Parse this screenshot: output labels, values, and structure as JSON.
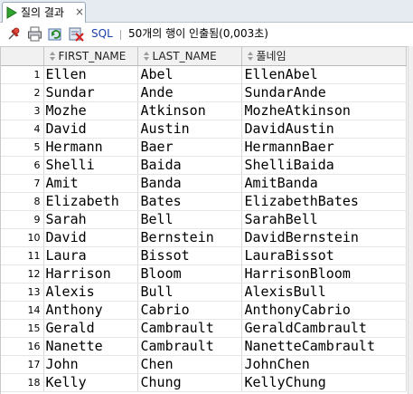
{
  "tab": {
    "label": "질의 결과",
    "close": "×"
  },
  "toolbar": {
    "sql_label": "SQL",
    "status": "50개의 행이 인출됨(0,003초)"
  },
  "columns": [
    "FIRST_NAME",
    "LAST_NAME",
    "풀네임"
  ],
  "rows": [
    [
      "1",
      "Ellen",
      "Abel",
      "EllenAbel"
    ],
    [
      "2",
      "Sundar",
      "Ande",
      "SundarAnde"
    ],
    [
      "3",
      "Mozhe",
      "Atkinson",
      "MozheAtkinson"
    ],
    [
      "4",
      "David",
      "Austin",
      "DavidAustin"
    ],
    [
      "5",
      "Hermann",
      "Baer",
      "HermannBaer"
    ],
    [
      "6",
      "Shelli",
      "Baida",
      "ShelliBaida"
    ],
    [
      "7",
      "Amit",
      "Banda",
      "AmitBanda"
    ],
    [
      "8",
      "Elizabeth",
      "Bates",
      "ElizabethBates"
    ],
    [
      "9",
      "Sarah",
      "Bell",
      "SarahBell"
    ],
    [
      "10",
      "David",
      "Bernstein",
      "DavidBernstein"
    ],
    [
      "11",
      "Laura",
      "Bissot",
      "LauraBissot"
    ],
    [
      "12",
      "Harrison",
      "Bloom",
      "HarrisonBloom"
    ],
    [
      "13",
      "Alexis",
      "Bull",
      "AlexisBull"
    ],
    [
      "14",
      "Anthony",
      "Cabrio",
      "AnthonyCabrio"
    ],
    [
      "15",
      "Gerald",
      "Cambrault",
      "GeraldCambrault"
    ],
    [
      "16",
      "Nanette",
      "Cambrault",
      "NanetteCambrault"
    ],
    [
      "17",
      "John",
      "Chen",
      "JohnChen"
    ],
    [
      "18",
      "Kelly",
      "Chung",
      "KellyChung"
    ]
  ]
}
